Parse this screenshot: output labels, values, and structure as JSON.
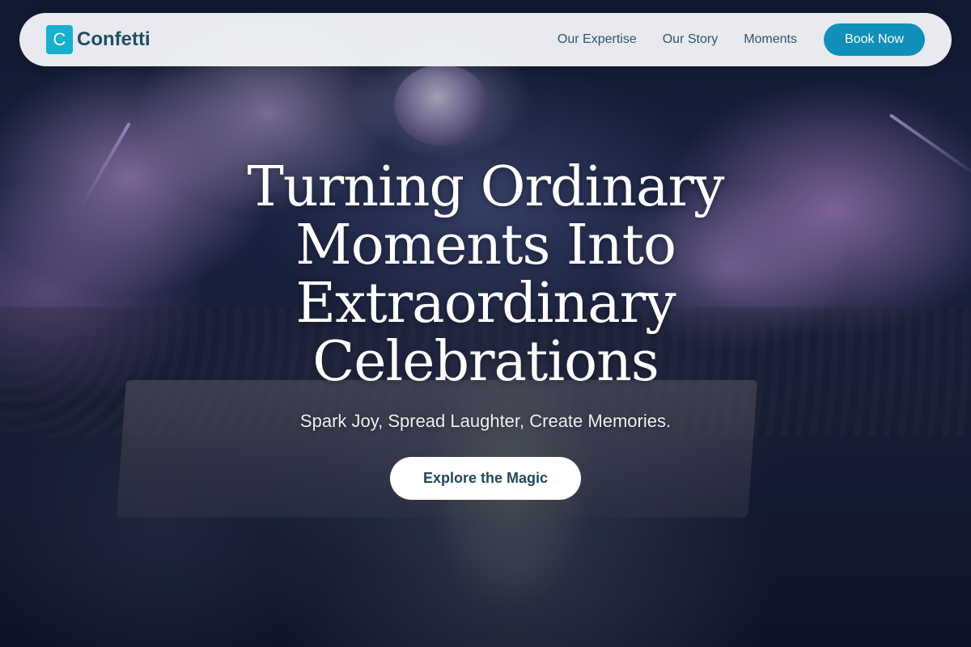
{
  "brand": {
    "logo_letter": "C",
    "name": "Confetti"
  },
  "nav": {
    "links": [
      {
        "label": "Our Expertise"
      },
      {
        "label": "Our Story"
      },
      {
        "label": "Moments"
      }
    ],
    "cta_label": "Book Now"
  },
  "hero": {
    "title": "Turning Ordinary Moments Into Extraordinary Celebrations",
    "subtitle": "Spark Joy, Spread Laughter, Create Memories.",
    "cta_label": "Explore the Magic",
    "background_icon": "party-dj-photo"
  },
  "colors": {
    "accent": "#1090b8",
    "logo": "#15b1cf",
    "brand_text": "#1f4d68",
    "nav_text": "#2e556f"
  }
}
